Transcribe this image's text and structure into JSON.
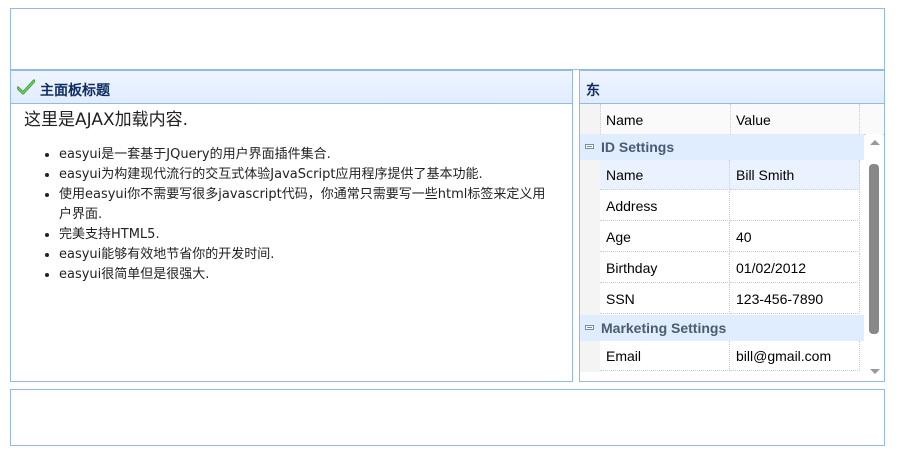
{
  "center_panel": {
    "title": "主面板标题",
    "icon": "check-icon",
    "intro": "这里是AJAX加载内容.",
    "features": [
      "easyui是一套基于JQuery的用户界面插件集合.",
      "easyui为构建现代流行的交互式体验JavaScript应用程序提供了基本功能.",
      "使用easyui你不需要写很多javascript代码，你通常只需要写一些html标签来定义用户界面.",
      "完美支持HTML5.",
      "easyui能够有效地节省你的开发时间.",
      "easyui很简单但是很强大."
    ]
  },
  "east_panel": {
    "title": "东",
    "grid": {
      "columns": [
        "Name",
        "Value"
      ],
      "groups": [
        {
          "name": "ID Settings",
          "rows": [
            {
              "name": "Name",
              "value": "Bill Smith"
            },
            {
              "name": "Address",
              "value": ""
            },
            {
              "name": "Age",
              "value": "40"
            },
            {
              "name": "Birthday",
              "value": "01/02/2012"
            },
            {
              "name": "SSN",
              "value": "123-456-7890"
            }
          ]
        },
        {
          "name": "Marketing Settings",
          "rows": [
            {
              "name": "Email",
              "value": "bill@gmail.com"
            }
          ]
        }
      ]
    }
  },
  "colors": {
    "border": "#95b8e7",
    "header_bg": "#e0ecff",
    "title_text": "#0e2d5f",
    "selected_row": "#eaf2ff"
  }
}
